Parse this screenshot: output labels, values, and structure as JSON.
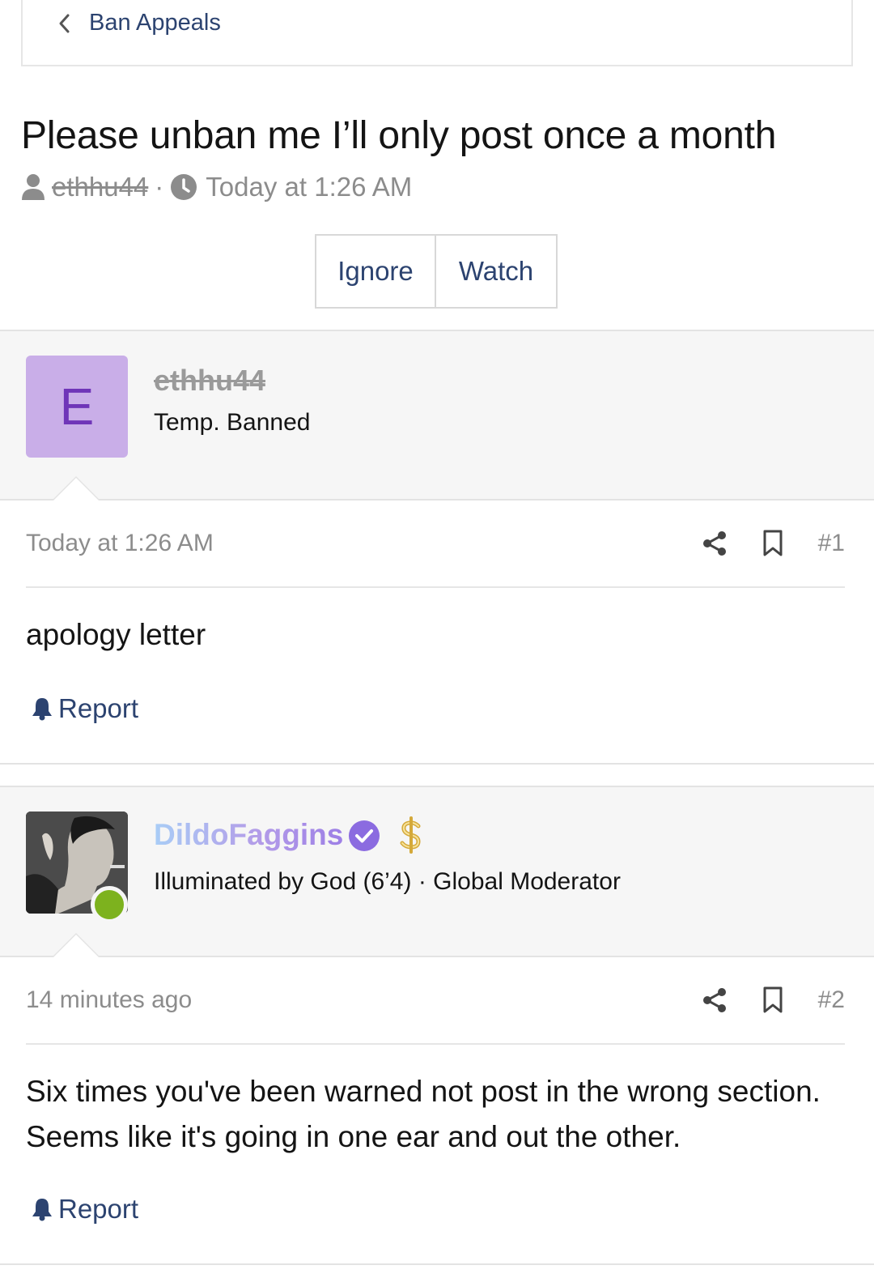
{
  "breadcrumb": {
    "label": "Ban Appeals",
    "icon": "chevron-left-icon"
  },
  "thread": {
    "title": "Please unban me I’ll only post once a month",
    "author": "ethhu44",
    "separator": "·",
    "time": "Today at 1:26 AM"
  },
  "buttons": {
    "ignore": "Ignore",
    "watch": "Watch"
  },
  "posts": [
    {
      "avatar_letter": "E",
      "avatar_bg": "#c9aee8",
      "username": "ethhu44",
      "user_title": "Temp. Banned",
      "time": "Today at 1:26 AM",
      "number": "#1",
      "body": "apology letter",
      "report": "Report"
    },
    {
      "username": "DildoFaggins",
      "user_title": "Illuminated by God (6’4) · Global Moderator",
      "online": true,
      "time": "14 minutes ago",
      "number": "#2",
      "body": "Six times you've been warned not post in the wrong section. Seems like it's going in one ear and out the other.",
      "report": "Report"
    }
  ],
  "colors": {
    "link": "#2c4370",
    "muted": "#8c8c8c",
    "online": "#7db21e",
    "verified": "#8b6be0"
  }
}
